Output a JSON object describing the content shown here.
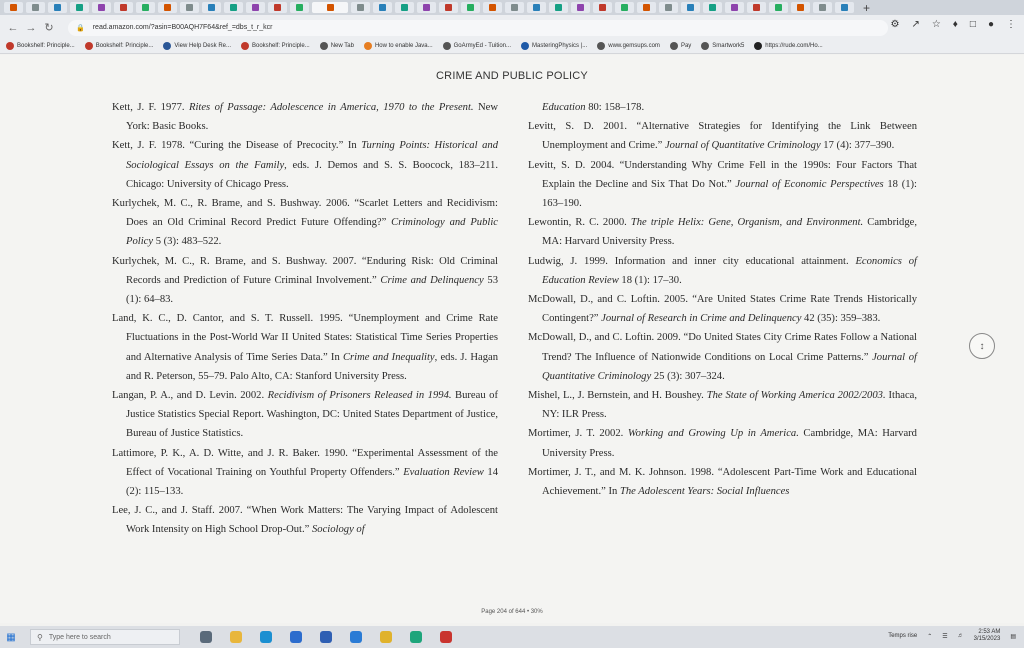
{
  "browser": {
    "tab_count": 38,
    "url": "read.amazon.com/?asin=B00AQH7F64&ref_=dbs_t_r_kcr",
    "new_tab_glyph": "+",
    "bookmarks": [
      {
        "label": "Bookshelf: Principle...",
        "icon": "bookmark-red-icon",
        "color": "#c0392b"
      },
      {
        "label": "Bookshelf: Principle...",
        "icon": "bookmark-red-icon",
        "color": "#c0392b"
      },
      {
        "label": "View Help Desk Re...",
        "icon": "helpdesk-icon",
        "color": "#2b5797"
      },
      {
        "label": "Bookshelf: Principle...",
        "icon": "bookmark-red-icon",
        "color": "#c0392b"
      },
      {
        "label": "New Tab",
        "icon": "globe-icon",
        "color": "#555555"
      },
      {
        "label": "How to enable Java...",
        "icon": "java-icon",
        "color": "#e67e22"
      },
      {
        "label": "GoArmyEd - Tuition...",
        "icon": "globe-icon",
        "color": "#555555"
      },
      {
        "label": "MasteringPhysics |...",
        "icon": "pearson-icon",
        "color": "#1e5aa8"
      },
      {
        "label": "www.gemsups.com",
        "icon": "globe-icon",
        "color": "#555555"
      },
      {
        "label": "Pay",
        "icon": "globe-icon",
        "color": "#555555"
      },
      {
        "label": "Smartwork5",
        "icon": "globe-icon",
        "color": "#555555"
      },
      {
        "label": "https://rude.com/Ho...",
        "icon": "info-icon",
        "color": "#222222"
      }
    ]
  },
  "document": {
    "title": "CRIME AND PUBLIC POLICY",
    "left_column": [
      {
        "pre": "Kett, J. F. 1977. ",
        "italic": "Rites of Passage: Adolescence in America, 1970 to the Present.",
        "post": " New York: Basic Books."
      },
      {
        "pre": "Kett, J. F. 1978. “Curing the Disease of Precocity.” In ",
        "italic": "Turning Points: Historical and Sociological Essays on the Family",
        "post": ", eds. J. Demos and S. S. Boocock, 183–211. Chicago: University of Chicago Press."
      },
      {
        "pre": "Kurlychek, M. C., R. Brame, and S. Bushway. 2006. “Scarlet Letters and Recidivism: Does an Old Criminal Record Predict Future Offending?” ",
        "italic": "Criminology and Public Policy",
        "post": " 5 (3): 483–522."
      },
      {
        "pre": "Kurlychek, M. C., R. Brame, and S. Bushway. 2007. “Enduring Risk: Old Criminal Records and Prediction of Future Criminal Involvement.” ",
        "italic": "Crime and Delinquency",
        "post": " 53 (1): 64–83."
      },
      {
        "pre": "Land, K. C., D. Cantor, and S. T. Russell. 1995. “Unemployment and Crime Rate Fluctuations in the Post-World War II United States: Statistical Time Series Properties and Alternative Analysis of Time Series Data.” In ",
        "italic": "Crime and Inequality",
        "post": ", eds. J. Hagan and R. Peterson, 55–79. Palo Alto, CA: Stanford University Press."
      },
      {
        "pre": "Langan, P. A., and D. Levin. 2002. ",
        "italic": "Recidivism of Prisoners Released in 1994.",
        "post": " Bureau of Justice Statistics Special Report. Washington, DC: United States Department of Justice, Bureau of Justice Statistics."
      },
      {
        "pre": "Lattimore, P. K., A. D. Witte, and J. R. Baker. 1990. “Experimental Assessment of the Effect of Vocational Training on Youthful Property Offenders.” ",
        "italic": "Evaluation Review",
        "post": " 14 (2): 115–133."
      },
      {
        "pre": "Lee, J. C., and J. Staff. 2007. “When Work Matters: The Varying Impact of Adolescent Work Intensity on High School Drop-Out.” ",
        "italic": "Sociology of",
        "post": ""
      }
    ],
    "right_column": [
      {
        "pre": "",
        "italic": "Education",
        "post": " 80: 158–178.",
        "continuation": true
      },
      {
        "pre": "Levitt, S. D. 2001. “Alternative Strategies for Identifying the Link Between Unemployment and Crime.” ",
        "italic": "Journal of Quantitative Criminology",
        "post": " 17 (4): 377–390."
      },
      {
        "pre": "Levitt, S. D. 2004. “Understanding Why Crime Fell in the 1990s: Four Factors That Explain the Decline and Six That Do Not.” ",
        "italic": "Journal of Economic Perspectives",
        "post": " 18 (1): 163–190."
      },
      {
        "pre": "Lewontin, R. C. 2000. ",
        "italic": "The triple Helix: Gene, Organism, and Environment.",
        "post": " Cambridge, MA: Harvard University Press."
      },
      {
        "pre": "Ludwig, J. 1999. Information and inner city educational attainment. ",
        "italic": "Economics of Education Review",
        "post": " 18 (1): 17–30."
      },
      {
        "pre": "McDowall, D., and C. Loftin. 2005. “Are United States Crime Rate Trends Historically Contingent?” ",
        "italic": "Journal of Research in Crime and Delinquency",
        "post": " 42 (35): 359–383."
      },
      {
        "pre": "McDowall, D., and C. Loftin. 2009. “Do United States City Crime Rates Follow a National Trend? The Influence of Nationwide Conditions on Local Crime Patterns.” ",
        "italic": "Journal of Quantitative Criminology",
        "post": " 25 (3): 307–324."
      },
      {
        "pre": "Mishel, L., J. Bernstein, and H. Boushey. ",
        "italic": "The State of Working America 2002/2003.",
        "post": " Ithaca, NY: ILR Press."
      },
      {
        "pre": "Mortimer, J. T. 2002. ",
        "italic": "Working and Growing Up in America.",
        "post": " Cambridge, MA: Harvard University Press."
      },
      {
        "pre": "Mortimer, J. T., and M. K. Johnson. 1998. “Adolescent Part-Time Work and Educational Achievement.” In ",
        "italic": "The Adolescent Years: Social Influences",
        "post": ""
      }
    ],
    "footer": "Page 204 of 644 • 30%"
  },
  "taskbar": {
    "search_placeholder": "Type here to search",
    "weather": "Temps rise",
    "time": "2:53 AM",
    "date": "3/15/2023",
    "apps": [
      {
        "icon": "task-view-icon",
        "color": "#5a6a7a"
      },
      {
        "icon": "file-explorer-icon",
        "color": "#e8b63c"
      },
      {
        "icon": "edge-icon",
        "color": "#1b8fd1"
      },
      {
        "icon": "store-icon",
        "color": "#2c6ccd"
      },
      {
        "icon": "mail-icon",
        "color": "#2f5fb3"
      },
      {
        "icon": "settings-app-icon",
        "color": "#2a7bd5"
      },
      {
        "icon": "chrome-icon",
        "color": "#e0b22c"
      },
      {
        "icon": "edge-dev-icon",
        "color": "#1ea57b"
      },
      {
        "icon": "security-icon",
        "color": "#c9342f"
      }
    ]
  }
}
